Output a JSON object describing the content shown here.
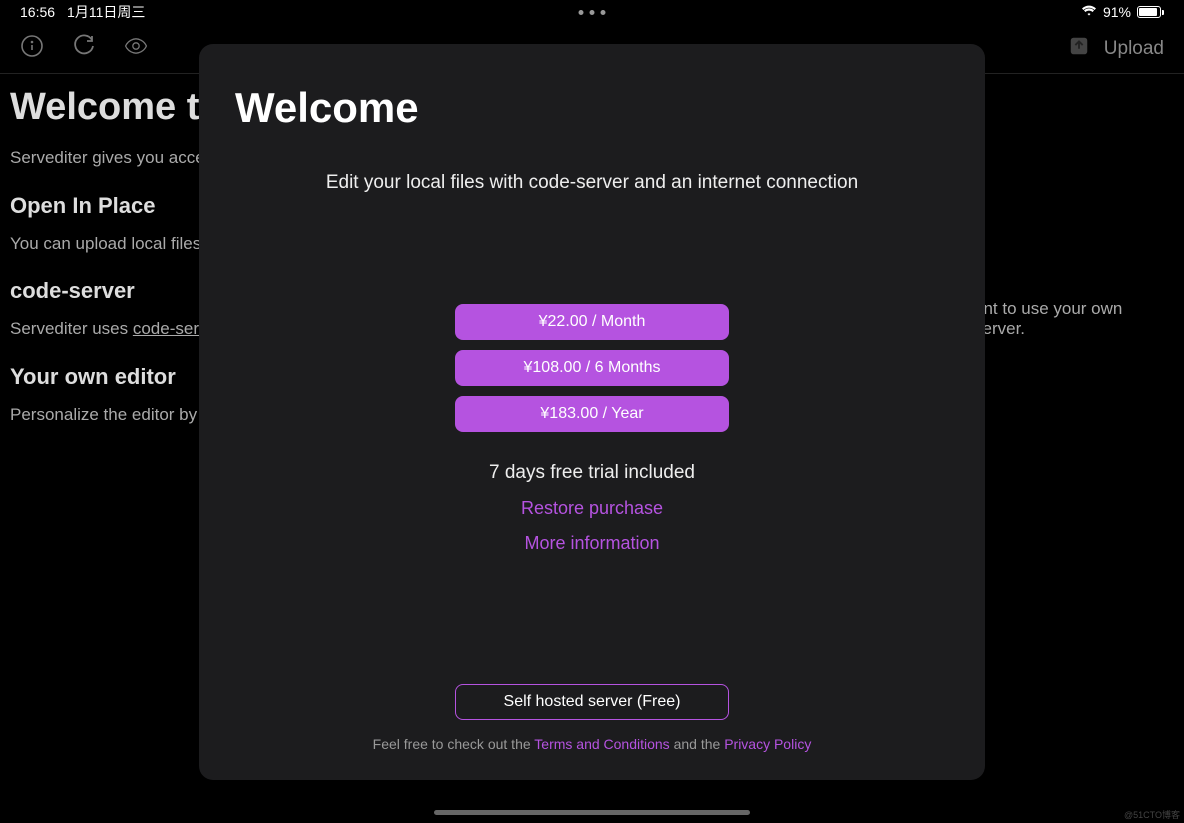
{
  "statusbar": {
    "time": "16:56",
    "date": "1月11日周三",
    "battery_pct": "91%"
  },
  "toolbar": {
    "upload_label": "Upload"
  },
  "background": {
    "title": "Welcome to S",
    "p1": "Servediter gives you access",
    "h2a": "Open In Place",
    "p2": "You can upload local files t",
    "h2b": "code-server",
    "p3_prefix": "Servediter uses ",
    "p3_link": "code-serv",
    "p3_right": "ant to use your own server.",
    "h2c": "Your own editor",
    "p4": "Personalize the editor by in"
  },
  "modal": {
    "title": "Welcome",
    "subtitle": "Edit your local files with code-server and an internet connection",
    "prices": [
      "¥22.00 / Month",
      "¥108.00 / 6 Months",
      "¥183.00 / Year"
    ],
    "trial": "7 days free trial included",
    "restore": "Restore purchase",
    "more_info": "More information",
    "self_hosted": "Self hosted server (Free)",
    "legal_prefix": "Feel free to check out the ",
    "legal_terms": "Terms and Conditions",
    "legal_mid": " and the ",
    "legal_privacy": "Privacy Policy"
  },
  "watermark": "@51CTO博客"
}
